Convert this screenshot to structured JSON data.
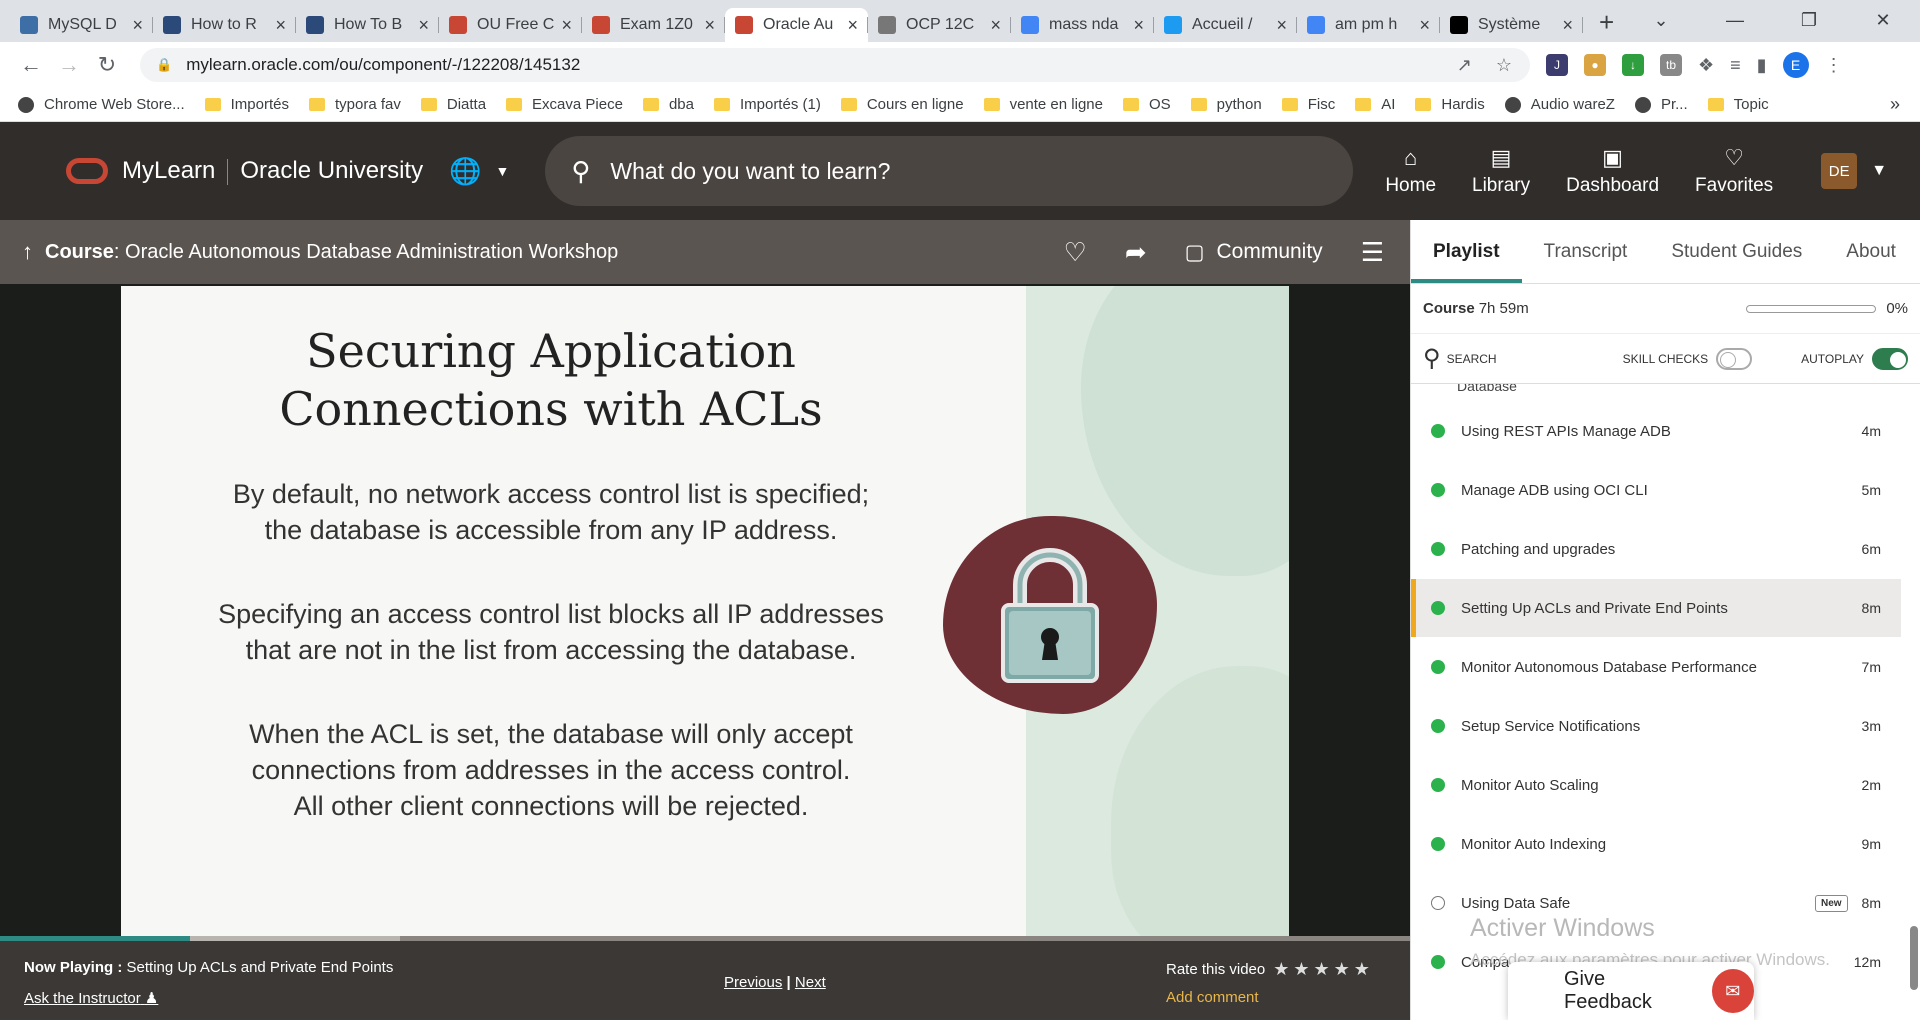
{
  "browser": {
    "tabs": [
      {
        "title": "MySQL D",
        "color": "#3d6ea5"
      },
      {
        "title": "How to R",
        "color": "#2b4a7a"
      },
      {
        "title": "How To B",
        "color": "#2b4a7a"
      },
      {
        "title": "OU Free C",
        "color": "#c74634"
      },
      {
        "title": "Exam 1Z0",
        "color": "#c74634"
      },
      {
        "title": "Oracle Au",
        "color": "#c74634"
      },
      {
        "title": "OCP 12C",
        "color": "#777777"
      },
      {
        "title": "mass nda",
        "color": "#4285f4"
      },
      {
        "title": "Accueil /",
        "color": "#1d9bf0"
      },
      {
        "title": "am pm h",
        "color": "#4285f4"
      },
      {
        "title": "Système",
        "color": "#000000"
      }
    ],
    "active_tab_index": 5,
    "url": "mylearn.oracle.com/ou/component/-/122208/145132",
    "profile_initial": "E",
    "bookmarks": [
      {
        "label": "Chrome Web Store...",
        "kind": "app"
      },
      {
        "label": "Importés",
        "kind": "folder"
      },
      {
        "label": "typora fav",
        "kind": "folder"
      },
      {
        "label": "Diatta",
        "kind": "folder"
      },
      {
        "label": "Excava Piece",
        "kind": "folder"
      },
      {
        "label": "dba",
        "kind": "folder"
      },
      {
        "label": "Importés (1)",
        "kind": "folder"
      },
      {
        "label": "Cours en ligne",
        "kind": "folder"
      },
      {
        "label": "vente en ligne",
        "kind": "folder"
      },
      {
        "label": "OS",
        "kind": "folder"
      },
      {
        "label": "python",
        "kind": "folder"
      },
      {
        "label": "Fisc",
        "kind": "folder"
      },
      {
        "label": "AI",
        "kind": "folder"
      },
      {
        "label": "Hardis",
        "kind": "folder"
      },
      {
        "label": "Audio wareZ",
        "kind": "app"
      },
      {
        "label": "Pr...",
        "kind": "app"
      },
      {
        "label": "Topic",
        "kind": "folder"
      }
    ]
  },
  "site": {
    "brand": "MyLearn",
    "brand_sub": "Oracle University",
    "search_placeholder": "What do you want to learn?",
    "nav": [
      {
        "label": "Home",
        "icon": "home-icon"
      },
      {
        "label": "Library",
        "icon": "library-icon"
      },
      {
        "label": "Dashboard",
        "icon": "dashboard-icon"
      },
      {
        "label": "Favorites",
        "icon": "heart-icon"
      }
    ],
    "avatar": "DE"
  },
  "course": {
    "prefix": "Course",
    "title": ": Oracle Autonomous Database Administration Workshop",
    "community": "Community"
  },
  "slide": {
    "title_line1": "Securing Application",
    "title_line2": "Connections with ACLs",
    "para1_line1": "By default, no network access control list is specified;",
    "para1_line2": "the database is accessible from any IP address.",
    "para2_line1": "Specifying an access control list blocks all IP addresses",
    "para2_line2": "that are not in the list from accessing the database.",
    "para3_line1": "When the ACL is set, the database will only accept",
    "para3_line2": "connections from addresses in the access control.",
    "para3_line3": "All other client connections will be rejected."
  },
  "player": {
    "now_playing_label": "Now Playing :",
    "now_playing_title": " Setting Up ACLs and Private End Points",
    "ask": "Ask the Instructor",
    "previous": "Previous",
    "divider": "|",
    "next": "Next",
    "rate": "Rate this video",
    "add_comment": "Add comment",
    "progress_fraction": 0.135
  },
  "panel": {
    "tabs": [
      "Playlist",
      "Transcript",
      "Student Guides",
      "About"
    ],
    "course_label": "Course",
    "course_duration": "7h 59m",
    "course_progress": "0%",
    "search": "SEARCH",
    "skill_checks": "SKILL CHECKS",
    "autoplay": "AUTOPLAY",
    "partial_item": "Database",
    "items": [
      {
        "label": "Using REST APIs Manage ADB",
        "duration": "4m",
        "status": "done"
      },
      {
        "label": "Manage ADB using OCI CLI",
        "duration": "5m",
        "status": "done"
      },
      {
        "label": "Patching and upgrades",
        "duration": "6m",
        "status": "done"
      },
      {
        "label": "Setting Up ACLs and Private End Points",
        "duration": "8m",
        "status": "active"
      },
      {
        "label": "Monitor Autonomous Database Performance",
        "duration": "7m",
        "status": "done"
      },
      {
        "label": "Setup Service Notifications",
        "duration": "3m",
        "status": "done"
      },
      {
        "label": "Monitor Auto Scaling",
        "duration": "2m",
        "status": "done"
      },
      {
        "label": "Monitor Auto Indexing",
        "duration": "9m",
        "status": "done"
      },
      {
        "label": "Using Data Safe",
        "duration": "8m",
        "status": "new",
        "badge": "New"
      },
      {
        "label": "Compa",
        "duration": "12m",
        "status": "done"
      }
    ]
  },
  "overlay": {
    "watermark_title": "Activer Windows",
    "watermark_sub": "Accédez aux paramètres pour activer Windows.",
    "feedback": "Give Feedback"
  }
}
